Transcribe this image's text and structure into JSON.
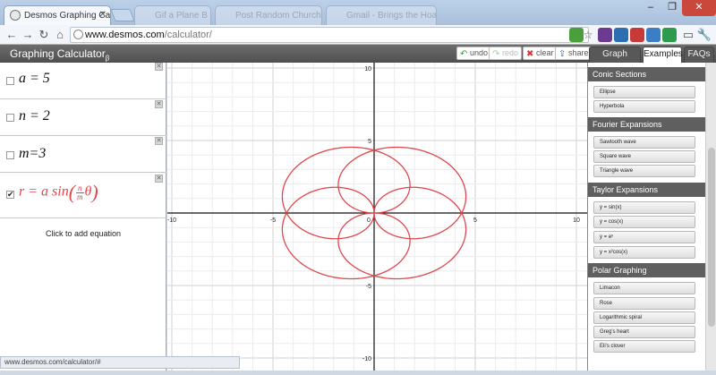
{
  "browser": {
    "tabs": [
      {
        "title": "Desmos Graphing Calculator",
        "active": true
      },
      {
        "title": "Gif a Plane B",
        "active": false
      },
      {
        "title": "Post Random Church Ma",
        "active": false
      },
      {
        "title": "Gmail - Brings the Hoard",
        "active": false
      }
    ],
    "url_host": "www.desmos.com",
    "url_path": "/calculator/",
    "status_url": "www.desmos.com/calculator/#"
  },
  "app": {
    "title": "Graphing Calculator",
    "title_suffix": "β",
    "buttons": {
      "undo": "undo",
      "redo": "redo",
      "clear": "clear",
      "share": "share"
    },
    "side_tabs": [
      "Graph Settings",
      "Examples",
      "FAQs"
    ]
  },
  "expressions": [
    {
      "text": "a = 5",
      "checked": false
    },
    {
      "text": "n = 2",
      "checked": false
    },
    {
      "text": "m=3",
      "checked": false
    },
    {
      "prefix": "r = a sin",
      "num": "n",
      "den": "m",
      "var": "θ",
      "checked": true
    }
  ],
  "add_equation": "Click to add equation",
  "examples": [
    {
      "heading": "Conic Sections",
      "items": [
        "Ellipse",
        "Hyperbola"
      ]
    },
    {
      "heading": "Fourier Expansions",
      "items": [
        "Sawtooth wave",
        "Square wave",
        "Triangle wave"
      ]
    },
    {
      "heading": "Taylor Expansions",
      "items": [
        "y = sin(x)",
        "y = cos(x)",
        "y = eˣ",
        "y = x²cos(x)"
      ]
    },
    {
      "heading": "Polar Graphing",
      "items": [
        "Limacon",
        "Rose",
        "Logarithmic spiral",
        "Greg's heart",
        "Eli's clover"
      ]
    }
  ],
  "chart_data": {
    "type": "line",
    "title": "",
    "xlabel": "",
    "ylabel": "",
    "xlim": [
      -10,
      10
    ],
    "ylim": [
      -10,
      10
    ],
    "grid": true,
    "x_ticks": [
      -10,
      -5,
      0,
      5,
      10
    ],
    "y_ticks": [
      10,
      5,
      -5,
      -10
    ],
    "series": [
      {
        "equation": "r = a sin((n/m)θ)",
        "a": 5,
        "n": 2,
        "m": 3,
        "theta_range": [
          0,
          18.85
        ],
        "color": "#e0474c"
      }
    ]
  },
  "colors": {
    "curve": "#e0474c",
    "header": "#555555",
    "axis": "#111111",
    "grid": "#e6e6e6"
  }
}
